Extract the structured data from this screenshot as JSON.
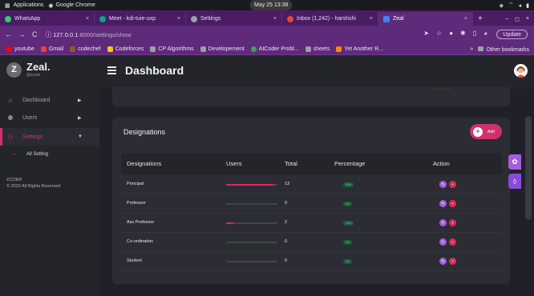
{
  "os_bar": {
    "applications": "Applications",
    "chrome_label": "Google Chrome",
    "clock": "May 25  13:38"
  },
  "tabs": [
    {
      "title": "WhatsApp",
      "color": "#25d366"
    },
    {
      "title": "Meet - kdi-tuie-uxp",
      "color": "#00a884"
    },
    {
      "title": "Settings",
      "color": "#9aa0a6"
    },
    {
      "title": "Inbox (1,242) - harshshi",
      "color": "#ea4335"
    },
    {
      "title": "Zeal",
      "color": "#3b82f6"
    }
  ],
  "address": {
    "host": "127.0.0.1",
    "path": ":8000/settings/show",
    "update": "Update"
  },
  "bookmarks": [
    {
      "label": "youtube",
      "color": "#ff0000"
    },
    {
      "label": "Gmail",
      "color": "#ea4335"
    },
    {
      "label": "codechef",
      "color": "#8b5a2b"
    },
    {
      "label": "Codeforces",
      "color": "#f3c623"
    },
    {
      "label": "CP Algorithms",
      "color": "#9aa0a6"
    },
    {
      "label": "Developement",
      "color": "#9aa0a6"
    },
    {
      "label": "AtCoder Probl...",
      "color": "#34a853"
    },
    {
      "label": "sheets",
      "color": "#9aa0a6"
    },
    {
      "label": "Yet Another R...",
      "color": "#ff8a00"
    }
  ],
  "bookmarks_other": "Other bookmarks",
  "brand": {
    "name": "Zeal.",
    "handle": "@zcoer",
    "logo_letter": "Z"
  },
  "sidebar": {
    "items": [
      {
        "label": "Dashboard",
        "icon": "home-icon",
        "glyph": "⌂"
      },
      {
        "label": "Users",
        "icon": "users-icon",
        "glyph": "👥"
      },
      {
        "label": "Settings",
        "icon": "settings-user-icon",
        "glyph": "⚙"
      }
    ],
    "sub_item": "All Setting",
    "footer_org": "ZCOER",
    "footer_rights": "© 2022 All Rights Reserved"
  },
  "header": {
    "title": "Dashboard"
  },
  "designations_card": {
    "title": "Designations",
    "add_label": "Add",
    "columns": [
      "Designations",
      "Users",
      "Total",
      "Percentage",
      "Action"
    ],
    "rows": [
      {
        "name": "Principal",
        "users_fraction": 0.93,
        "total": "13",
        "percentage": "93%"
      },
      {
        "name": "Professor",
        "users_fraction": 0.0,
        "total": "0",
        "percentage": "0%"
      },
      {
        "name": "Ass Professor",
        "users_fraction": 0.14,
        "total": "2",
        "percentage": "14%"
      },
      {
        "name": "Co-ordination",
        "users_fraction": 0.0,
        "total": "0",
        "percentage": "0%"
      },
      {
        "name": "Student",
        "users_fraction": 0.0,
        "total": "0",
        "percentage": "0%"
      }
    ]
  },
  "colors": {
    "accent": "#d1316b",
    "edit": "#a45de0",
    "delete": "#e0295a",
    "success": "#55d693"
  }
}
